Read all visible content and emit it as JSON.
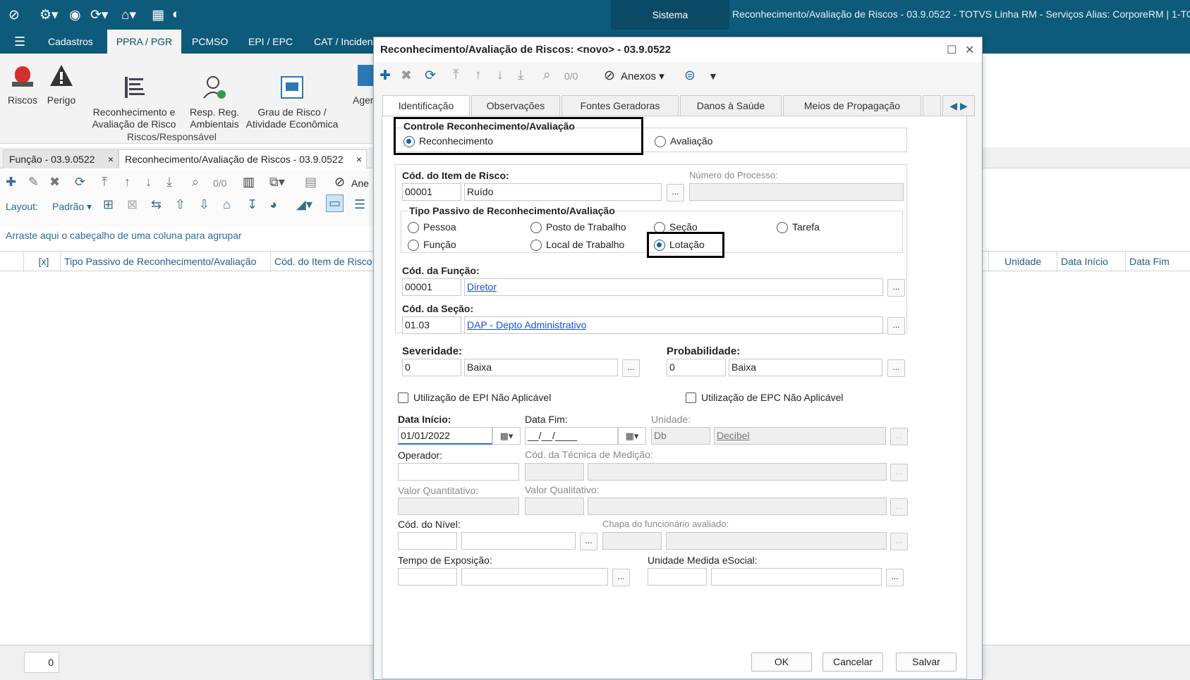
{
  "window": {
    "system_label": "Sistema",
    "app_title": "Reconhecimento/Avaliação de Riscos - 03.9.0522 - TOTVS Linha RM - Serviços  Alias: CorporeRM | 1-TO"
  },
  "ribbon_tabs": [
    "Cadastros",
    "PPRA / PGR",
    "PCMSO",
    "EPI / EPC",
    "CAT / Inciden"
  ],
  "ribbon": {
    "buttons": [
      {
        "label": "Riscos"
      },
      {
        "label": "Perigo"
      },
      {
        "label": "Reconhecimento e\nAvaliação de Risco"
      },
      {
        "label": "Resp. Reg.\nAmbientais"
      },
      {
        "label": "Grau de Risco /\nAtividade Econômica"
      },
      {
        "label": "Agen"
      }
    ],
    "group_label": "Riscos/Responsável"
  },
  "doc_tabs": [
    {
      "label": "Função - 03.9.0522"
    },
    {
      "label": "Reconhecimento/Avaliação de Riscos - 03.9.0522"
    }
  ],
  "list": {
    "record_count": "0/0",
    "attachments_label": "Ane",
    "layout_label": "Layout:",
    "layout_value": "Padrão",
    "group_hint": "Arraste aqui o cabeçalho de uma coluna para agrupar",
    "columns": [
      "[x]",
      "Tipo Passivo de Reconhecimento/Avaliação",
      "Cód. do Item de Risco",
      "Unidade",
      "Data Início",
      "Data Fim"
    ],
    "footer_count": "0"
  },
  "dialog": {
    "title": "Reconhecimento/Avaliação de Riscos: <novo> - 03.9.0522",
    "record_count": "0/0",
    "attachments_label": "Anexos",
    "tabs": [
      "Identificação",
      "Observações",
      "Fontes Geradoras",
      "Danos à Saúde",
      "Meios de Propagação"
    ],
    "controle": {
      "title": "Controle Reconhecimento/Avaliação",
      "opt1": "Reconhecimento",
      "opt2": "Avaliação"
    },
    "item_risco": {
      "label": "Cód. do Item de Risco:",
      "code": "00001",
      "desc": "Ruído",
      "processo_label": "Número do Processo:",
      "processo_value": ""
    },
    "tipo_passivo": {
      "title": "Tipo Passivo de Reconhecimento/Avaliação",
      "options": [
        "Pessoa",
        "Posto de Trabalho",
        "Seção",
        "Tarefa",
        "Função",
        "Local de Trabalho",
        "Lotação"
      ],
      "selected": "Lotação"
    },
    "funcao": {
      "label": "Cód. da Função:",
      "code": "00001",
      "desc": "Diretor"
    },
    "secao": {
      "label": "Cód. da Seção:",
      "code": "01.03",
      "desc": "DAP - Depto Administrativo"
    },
    "severidade": {
      "label": "Severidade:",
      "code": "0",
      "desc": "Baixa"
    },
    "probabilidade": {
      "label": "Probabilidade:",
      "code": "0",
      "desc": "Baixa"
    },
    "epi_na": "Utilização de EPI Não Aplicável",
    "epc_na": "Utilização de EPC Não Aplicável",
    "data_inicio": {
      "label": "Data Início:",
      "value": "01/01/2022"
    },
    "data_fim": {
      "label": "Data Fim:",
      "value": "__/__/____"
    },
    "unidade": {
      "label": "Unidade:",
      "code": "Db",
      "desc": "Decibel"
    },
    "operador": {
      "label": "Operador:",
      "value": ""
    },
    "tecnica": {
      "label": "Cód. da Técnica de Medição:"
    },
    "valor_quant": {
      "label": "Valor Quantitativo:"
    },
    "valor_qual": {
      "label": "Valor Qualitativo:"
    },
    "nivel": {
      "label": "Cód. do Nível:"
    },
    "chapa": {
      "label": "Chapa do funcionário avaliado:"
    },
    "tempo": {
      "label": "Tempo de Exposição:"
    },
    "unidade_esocial": {
      "label": "Unidade Medida eSocial:"
    },
    "buttons": {
      "ok": "OK",
      "cancel": "Cancelar",
      "save": "Salvar"
    }
  },
  "colors": {
    "titlebar": "#0e5a7a",
    "accent": "#1b5fa8",
    "highlight_border": "#000000"
  }
}
